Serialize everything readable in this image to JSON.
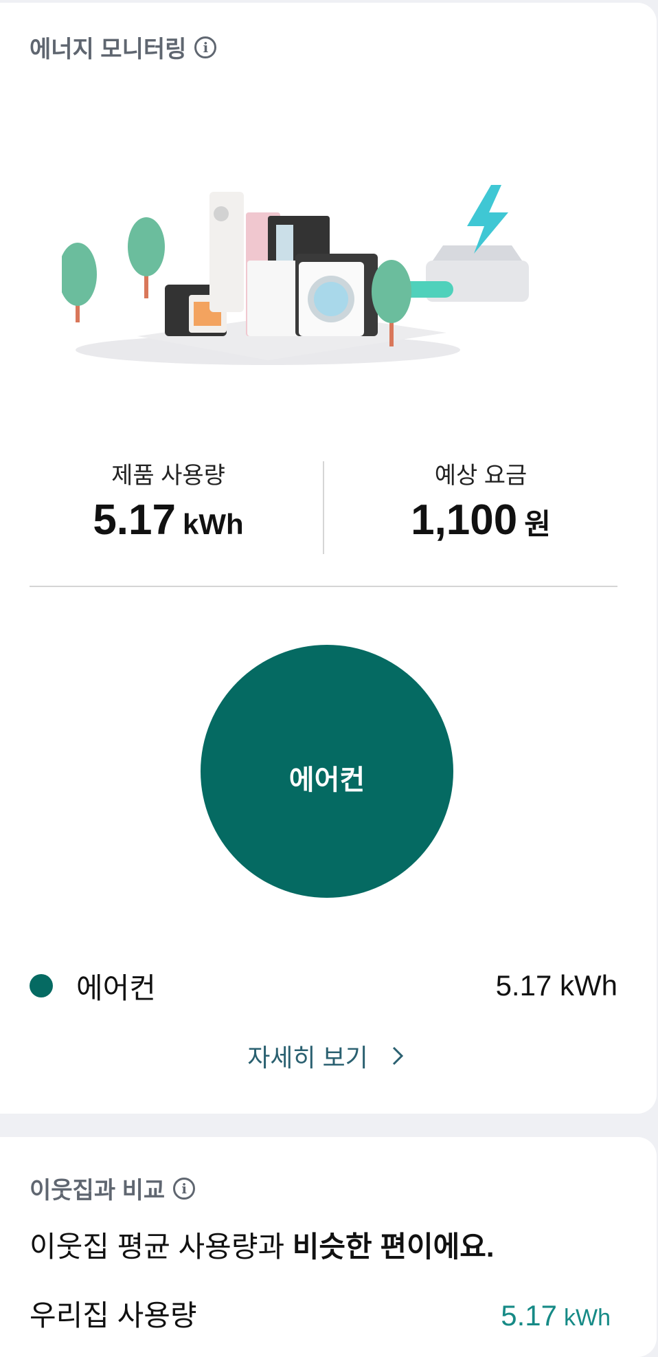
{
  "energy_card": {
    "title": "에너지 모니터링",
    "usage_label": "제품 사용량",
    "usage_value": "5.17",
    "usage_unit": "kWh",
    "cost_label": "예상 요금",
    "cost_value": "1,100",
    "cost_unit": "원",
    "pie_center_label": "에어컨",
    "legend": [
      {
        "name": "에어컨",
        "value": "5.17 kWh",
        "color": "#056a62"
      }
    ],
    "more_link": "자세히 보기"
  },
  "compare_card": {
    "title": "이웃집과 비교",
    "headline_prefix": "이웃집 평균 사용량과 ",
    "headline_bold": "비슷한 편이에요.",
    "ours_label": "우리집 사용량",
    "ours_value": "5.17",
    "ours_unit": "kWh"
  },
  "colors": {
    "accent": "#056a62",
    "link": "#2a6070",
    "value_teal": "#168a86"
  },
  "chart_data": {
    "type": "pie",
    "categories": [
      "에어컨"
    ],
    "values": [
      5.17
    ]
  }
}
